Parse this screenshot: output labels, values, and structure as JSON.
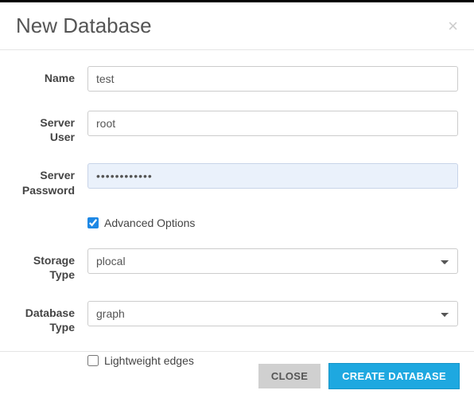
{
  "modal": {
    "title": "New Database",
    "close_x": "×"
  },
  "form": {
    "name_label": "Name",
    "name_value": "test",
    "server_user_label": "Server User",
    "server_user_value": "root",
    "server_password_label": "Server Password",
    "server_password_value": "••••••••••••",
    "advanced_options_label": "Advanced Options",
    "advanced_options_checked": true,
    "storage_type_label": "Storage Type",
    "storage_type_value": "plocal",
    "database_type_label": "Database Type",
    "database_type_value": "graph",
    "lightweight_edges_label": "Lightweight edges",
    "lightweight_edges_checked": false
  },
  "footer": {
    "close_label": "CLOSE",
    "create_label": "CREATE DATABASE"
  }
}
